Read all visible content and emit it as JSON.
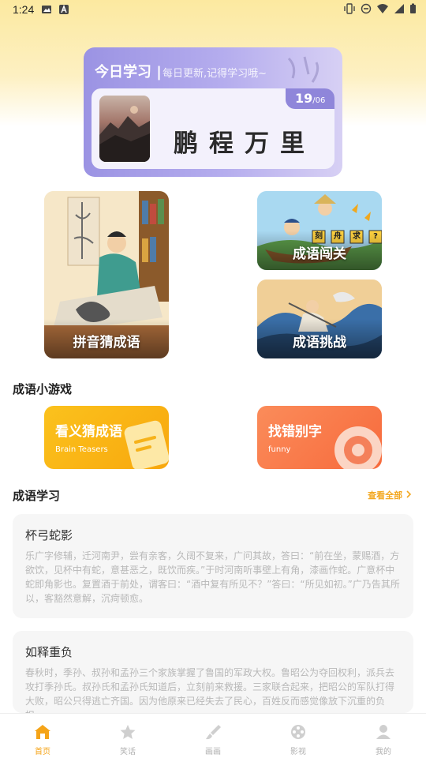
{
  "status_bar": {
    "time": "1:24"
  },
  "today": {
    "title": "今日学习 |",
    "subtitle": "每日更新,记得学习哦~",
    "date_day": "19",
    "date_month": "/06",
    "idiom": "鹏程万里"
  },
  "features": {
    "pinyin": "拼音猜成语",
    "chuangguan": "成语闯关",
    "tiaozhan": "成语挑战",
    "chuangguan_tiles": [
      "刻",
      "舟",
      "求",
      "?"
    ]
  },
  "games_section": {
    "title": "成语小游戏",
    "items": [
      {
        "title": "看义猜成语",
        "sub": "Brain Teasers"
      },
      {
        "title": "找错别字",
        "sub": "funny"
      }
    ]
  },
  "study_section": {
    "title": "成语学习",
    "see_all": "查看全部",
    "items": [
      {
        "title": "杯弓蛇影",
        "body": "乐广字修辅，迁河南尹，尝有亲客，久阔不复来，广问其故，答曰：“前在坐，蒙赐酒，方欲饮，见杯中有蛇，意甚恶之，既饮而疾。”于时河南听事壁上有角，漆画作蛇。广意杯中蛇即角影也。复置酒于前处，谓客曰：“酒中复有所见不？”答曰：“所见如初。”广乃告其所以，客豁然意解，沉疴顿愈。"
      },
      {
        "title": "如释重负",
        "body": "春秋时，季孙、叔孙和孟孙三个家族掌握了鲁国的军政大权。鲁昭公为夺回权利，派兵去攻打季孙氏。叔孙氏和孟孙氏知道后，立刻前来救援。三家联合起来，把昭公的军队打得大败，昭公只得逃亡齐国。因为他原来已经失去了民心，百姓反而感觉像放下沉重的负担。"
      }
    ]
  },
  "nav": [
    {
      "label": "首页",
      "icon": "home-icon",
      "active": true
    },
    {
      "label": "笑话",
      "icon": "star-icon",
      "active": false
    },
    {
      "label": "画画",
      "icon": "brush-icon",
      "active": false
    },
    {
      "label": "影视",
      "icon": "film-reel-icon",
      "active": false
    },
    {
      "label": "我的",
      "icon": "user-icon",
      "active": false
    }
  ],
  "colors": {
    "accent": "#f5a418",
    "today_card": "#9b93e3",
    "game_yellow": "#fbc21d",
    "game_orange": "#f76a3c"
  }
}
